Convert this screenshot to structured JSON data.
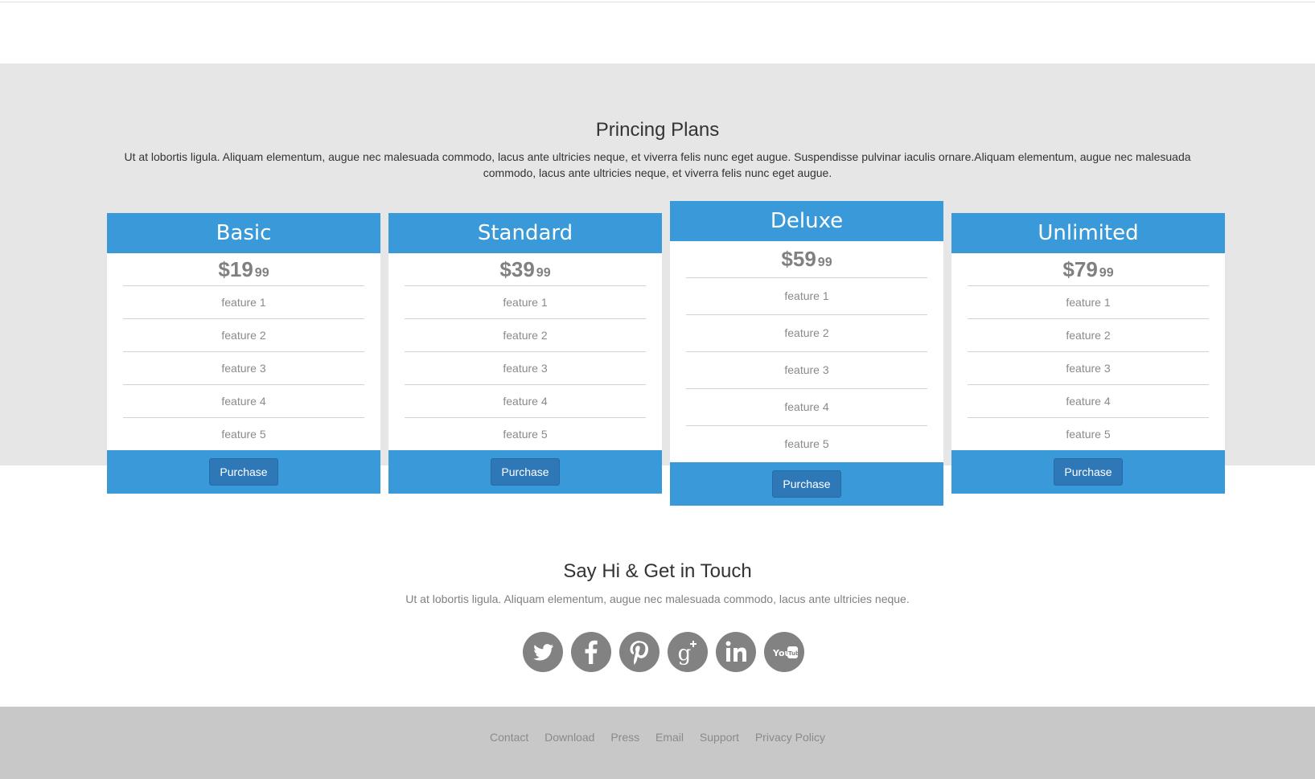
{
  "pricing": {
    "title": "Princing Plans",
    "description": "Ut at lobortis ligula. Aliquam elementum, augue nec malesuada commodo, lacus ante ultricies neque, et viverra felis nunc eget augue. Suspendisse pulvinar iaculis ornare.Aliquam elementum, augue nec malesuada commodo, lacus ante ultricies neque, et viverra felis nunc eget augue.",
    "plans": [
      {
        "name": "Basic",
        "price": "$19",
        "cents": "99",
        "features": [
          "feature 1",
          "feature 2",
          "feature 3",
          "feature 4",
          "feature 5"
        ],
        "button": "Purchase"
      },
      {
        "name": "Standard",
        "price": "$39",
        "cents": "99",
        "features": [
          "feature 1",
          "feature 2",
          "feature 3",
          "feature 4",
          "feature 5"
        ],
        "button": "Purchase"
      },
      {
        "name": "Deluxe",
        "price": "$59",
        "cents": "99",
        "features": [
          "feature 1",
          "feature 2",
          "feature 3",
          "feature 4",
          "feature 5"
        ],
        "button": "Purchase"
      },
      {
        "name": "Unlimited",
        "price": "$79",
        "cents": "99",
        "features": [
          "feature 1",
          "feature 2",
          "feature 3",
          "feature 4",
          "feature 5"
        ],
        "button": "Purchase"
      }
    ]
  },
  "contact": {
    "title": "Say Hi & Get in Touch",
    "description": "Ut at lobortis ligula. Aliquam elementum, augue nec malesuada commodo, lacus ante ultricies neque.",
    "social_icons": [
      "twitter-icon",
      "facebook-icon",
      "pinterest-icon",
      "google-plus-icon",
      "linkedin-icon",
      "youtube-icon"
    ]
  },
  "footer": {
    "links": [
      "Contact",
      "Download",
      "Press",
      "Email",
      "Support",
      "Privacy Policy"
    ]
  },
  "colors": {
    "accent": "#3a9ad9",
    "button": "#2e78b8",
    "pricing_background": "#e6e6e6",
    "footer_background": "#c8c8c8",
    "social_icon": "#828282"
  }
}
